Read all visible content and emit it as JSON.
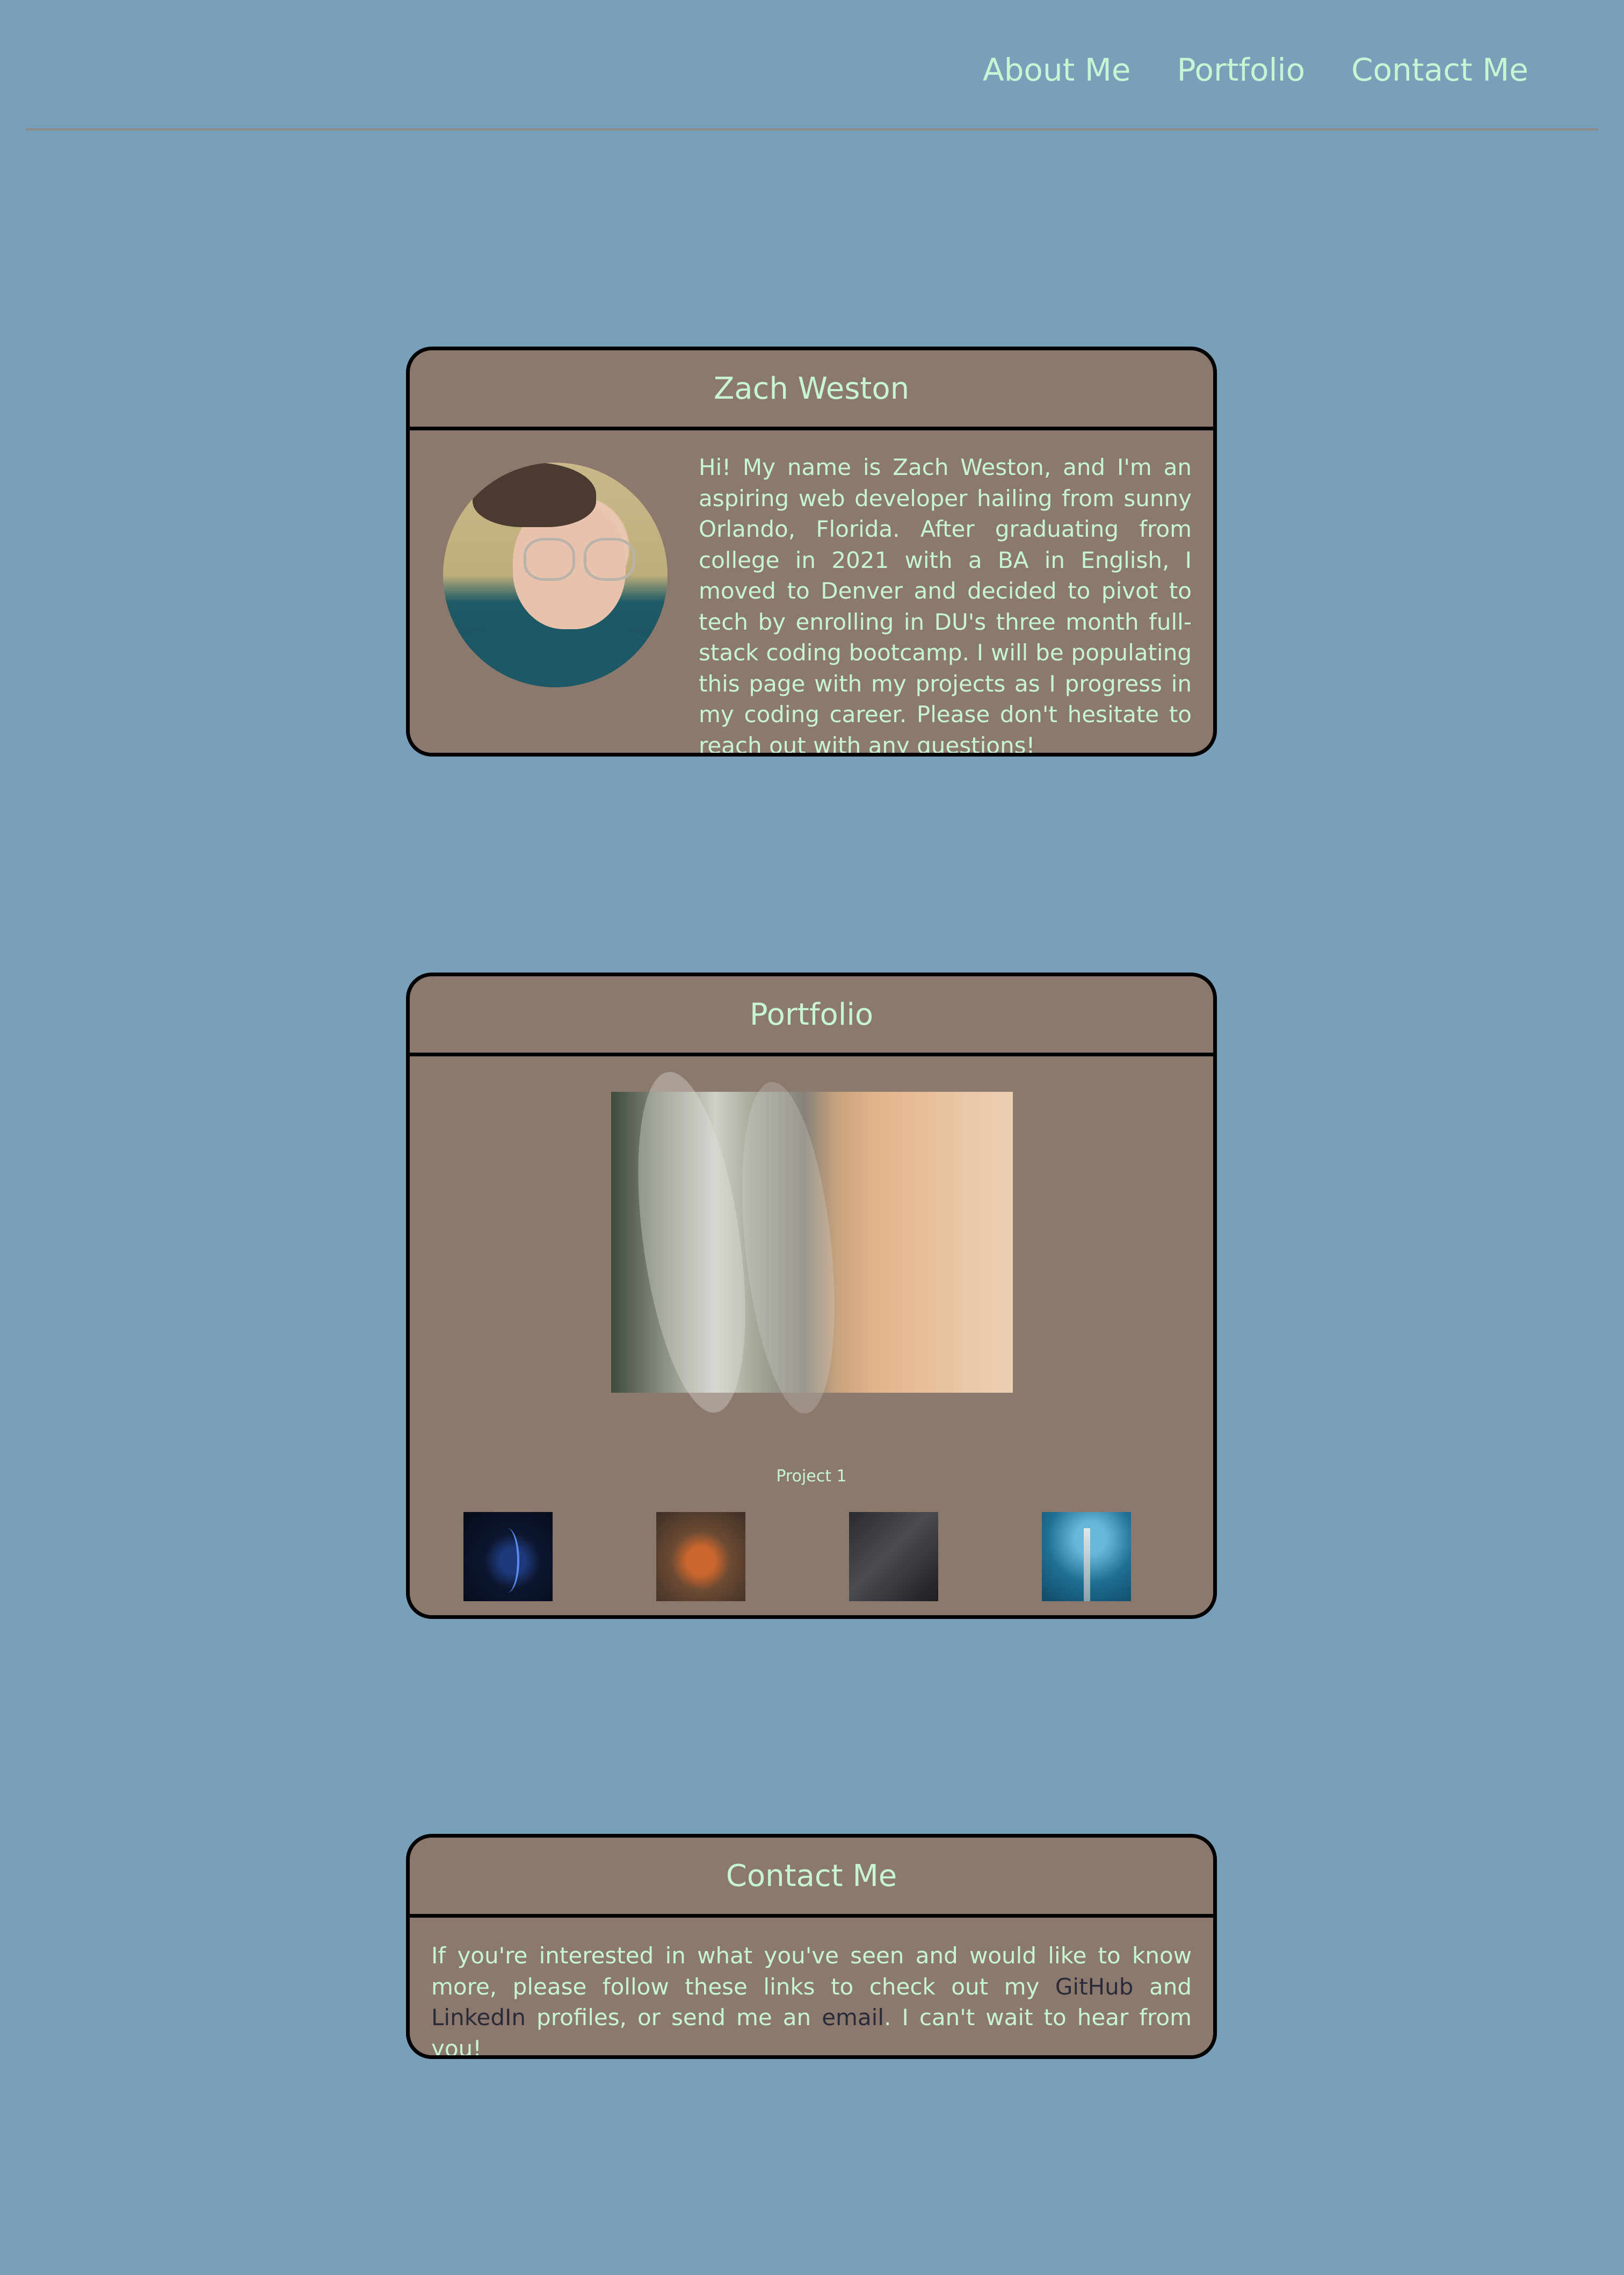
{
  "nav": {
    "items": [
      {
        "label": "About Me"
      },
      {
        "label": "Portfolio"
      },
      {
        "label": "Contact Me"
      }
    ]
  },
  "about": {
    "title": "Zach Weston",
    "text": "Hi! My name is Zach Weston, and I'm an aspiring web developer hailing from sunny Orlando, Florida. After graduating from college in 2021 with a BA in English, I moved to Denver and decided to pivot to tech by enrolling in DU's three month full-stack coding bootcamp. I will be populating this page with my projects as I progress in my coding career. Please don't hesitate to reach out with any questions!"
  },
  "portfolio": {
    "title": "Portfolio",
    "caption": "Project 1"
  },
  "contact": {
    "title": "Contact Me",
    "text_1": "If you're interested in what you've seen and would like to know more, please follow these links to check out my ",
    "github": "GitHub",
    "text_2": " and ",
    "linkedin": "LinkedIn",
    "text_3": " profiles, or send me an ",
    "email": "email",
    "text_4": ". I can't wait to hear from you!"
  },
  "colors": {
    "background": "#78a0ba",
    "card": "#8c796d",
    "text": "#c7f5d3",
    "link": "#2b2a3a"
  }
}
